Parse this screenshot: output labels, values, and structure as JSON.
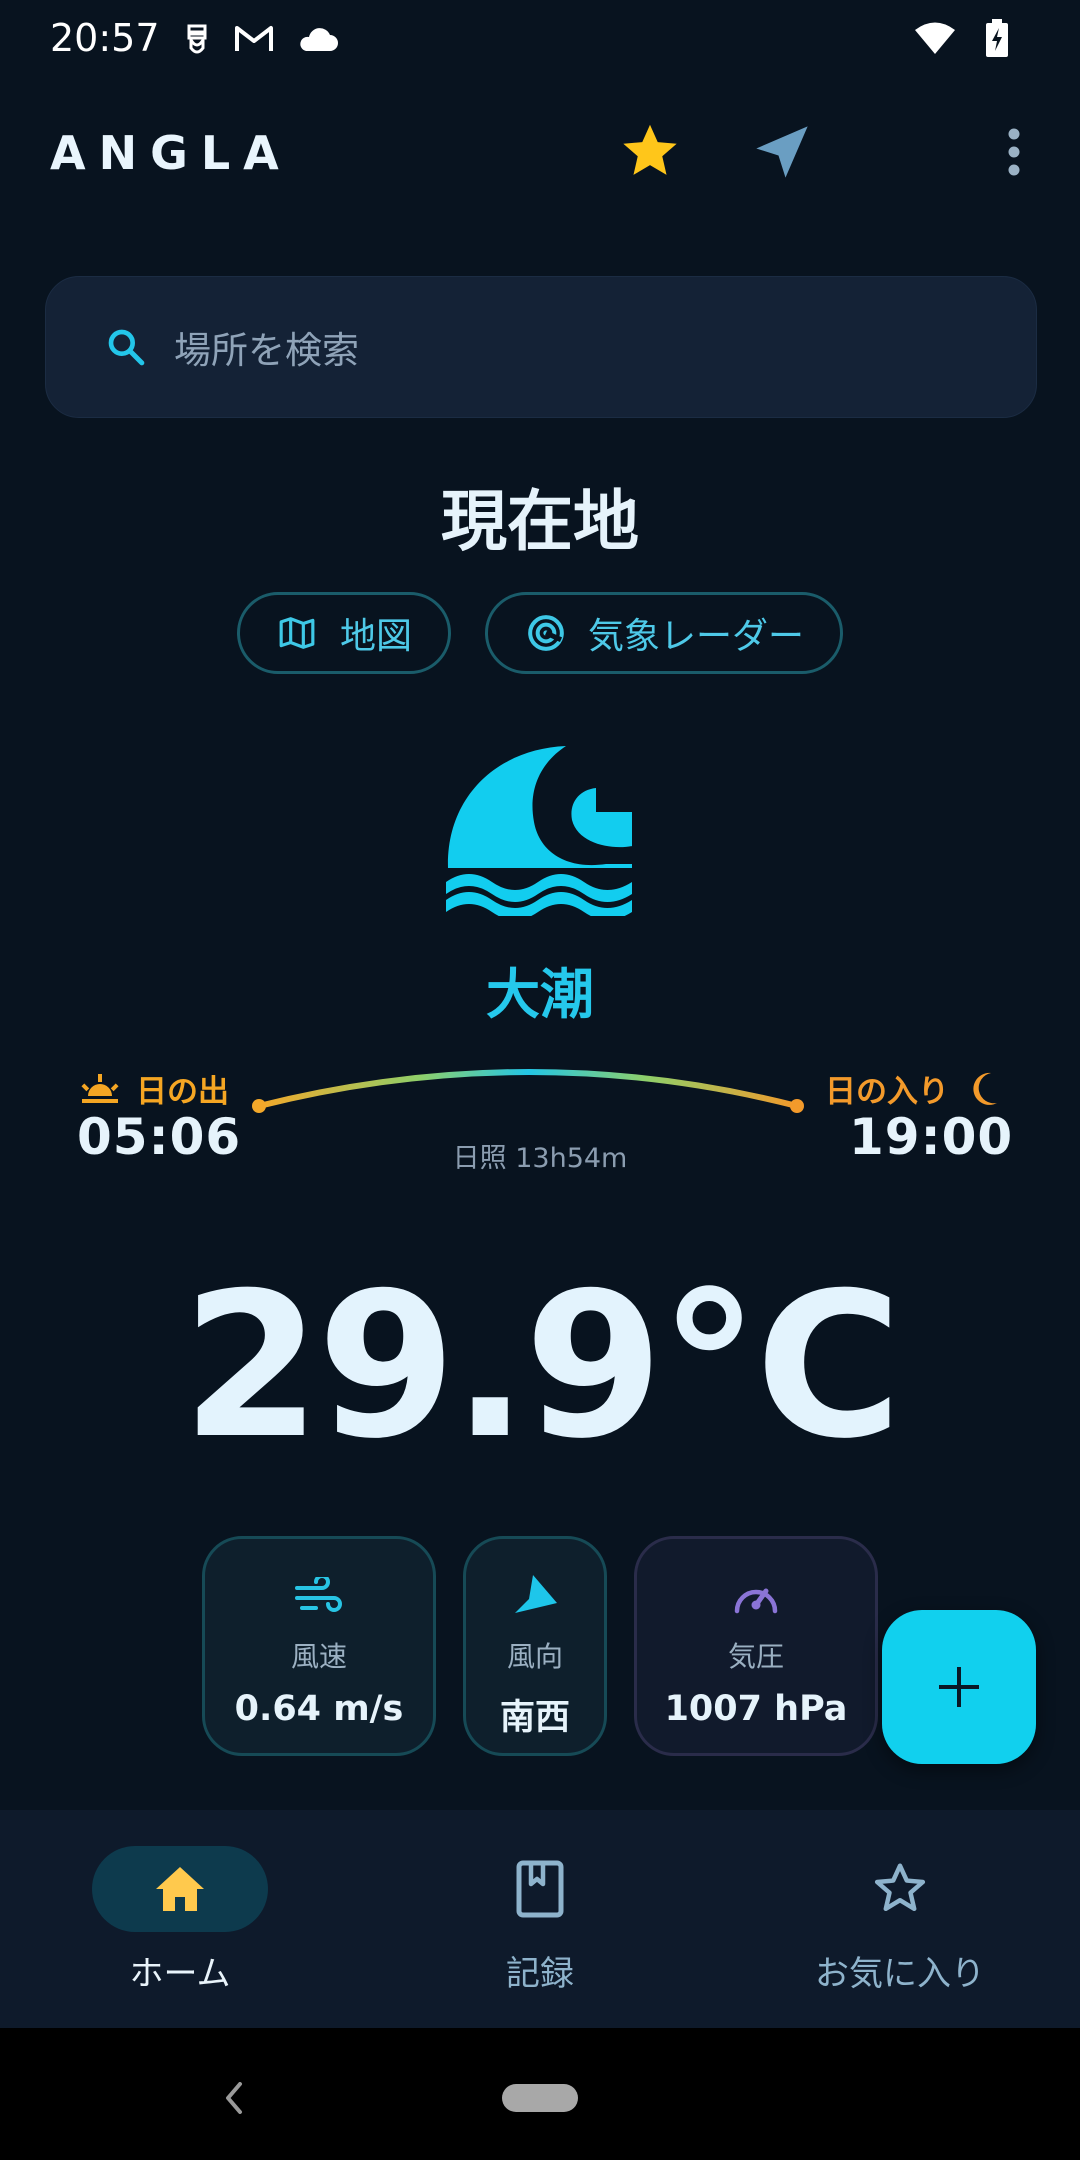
{
  "status_bar": {
    "time": "20:57"
  },
  "app_bar": {
    "title": "ANGLA"
  },
  "search": {
    "placeholder": "場所を検索"
  },
  "location": {
    "title": "現在地"
  },
  "chips": {
    "map_label": "地図",
    "radar_label": "気象レーダー"
  },
  "tide": {
    "name": "大潮",
    "icon": "tide-wave-moon-icon"
  },
  "sun": {
    "sunrise_label": "日の出",
    "sunrise_time": "05:06",
    "sunset_label": "日の入り",
    "sunset_time": "19:00",
    "daylight": "日照 13h54m"
  },
  "weather": {
    "temperature": "29.9°C",
    "cards": {
      "wind_speed": {
        "label": "風速",
        "value": "0.64 m/s"
      },
      "wind_direction": {
        "label": "風向",
        "value": "南西"
      },
      "pressure": {
        "label": "気圧",
        "value": "1007 hPa"
      }
    }
  },
  "bottom_nav": {
    "home": "ホーム",
    "records": "記録",
    "favorites": "お気に入り"
  },
  "colors": {
    "background": "#08131f",
    "accent": "#11d0ee",
    "star": "#ffc61a",
    "sunrise": "#f5a623",
    "sunset": "#f39a2b",
    "pressure_icon": "#8a74d6"
  }
}
